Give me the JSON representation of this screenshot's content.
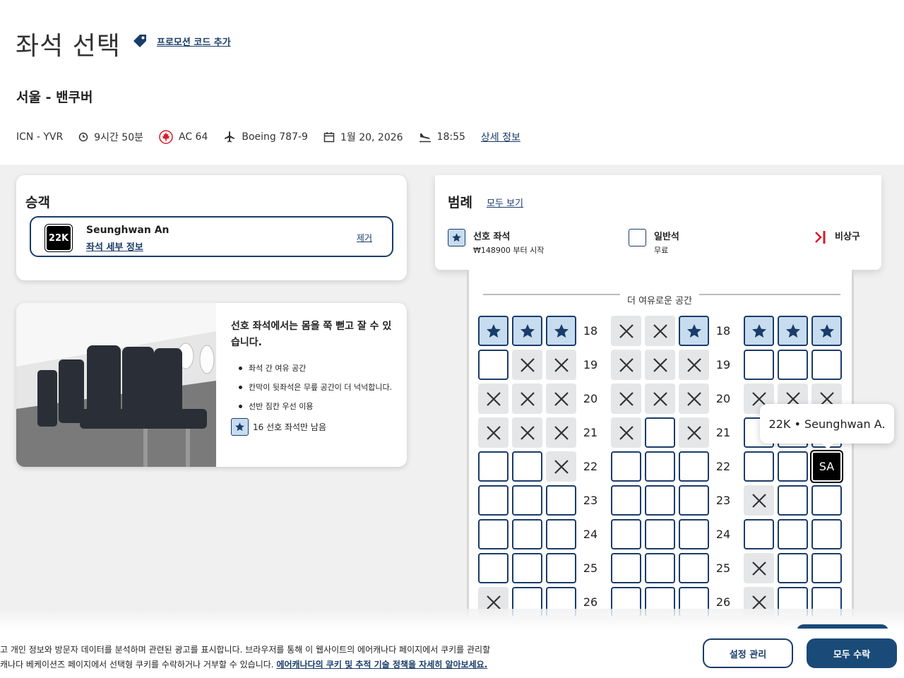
{
  "header": {
    "title": "좌석 선택",
    "promo_link": "프로모션 코드 추가",
    "route": "서울 - 밴쿠버",
    "flight": {
      "airports": "ICN - YVR",
      "duration": "9시간 50분",
      "flight_number": "AC 64",
      "aircraft": "Boeing 787-9",
      "date": "1월 20, 2026",
      "arrival_time": "18:55",
      "details_link": "상세 정보"
    }
  },
  "passenger": {
    "heading": "승객",
    "seat": "22K",
    "name": "Seunghwan An",
    "seat_details_link": "좌석 세부 정보",
    "remove_link": "제거"
  },
  "preferred_info": {
    "title": "선호 좌석에서는 몸을 쭉 뻗고 잘 수 있습니다.",
    "bullets": [
      "좌석 간 여유 공간",
      "칸막이 뒷좌석은 무릎 공간이 더 넉넉합니다.",
      "선반 짐칸 우선 이용"
    ],
    "remaining": "16 선호 좌석만 남음"
  },
  "legend": {
    "heading": "범례",
    "see_all": "모두 보기",
    "preferred_label": "선호 좌석",
    "preferred_price": "₩148900 부터 시작",
    "regular_label": "일반석",
    "regular_price": "무료",
    "exit_label": "비상구"
  },
  "seatmap": {
    "section_label": "더 여유로운 공간",
    "rows": [
      {
        "num": "18",
        "seats": [
          "P",
          "P",
          "P",
          "X",
          "X",
          "P",
          "P",
          "P",
          "P"
        ]
      },
      {
        "num": "19",
        "seats": [
          "A",
          "X",
          "X",
          "X",
          "X",
          "X",
          "A",
          "A",
          "A"
        ]
      },
      {
        "num": "20",
        "seats": [
          "X",
          "X",
          "X",
          "X",
          "X",
          "X",
          "X",
          "X",
          "X"
        ]
      },
      {
        "num": "21",
        "seats": [
          "X",
          "X",
          "X",
          "X",
          "A",
          "X",
          "A",
          "A",
          "A"
        ]
      },
      {
        "num": "22",
        "seats": [
          "A",
          "A",
          "X",
          "A",
          "A",
          "A",
          "A",
          "A",
          "S"
        ]
      },
      {
        "num": "23",
        "seats": [
          "A",
          "A",
          "A",
          "A",
          "A",
          "A",
          "X",
          "A",
          "A"
        ]
      },
      {
        "num": "24",
        "seats": [
          "A",
          "A",
          "A",
          "A",
          "A",
          "A",
          "A",
          "A",
          "A"
        ]
      },
      {
        "num": "25",
        "seats": [
          "A",
          "A",
          "A",
          "A",
          "A",
          "A",
          "X",
          "A",
          "A"
        ]
      },
      {
        "num": "26",
        "seats": [
          "X",
          "A",
          "A",
          "A",
          "A",
          "A",
          "X",
          "A",
          "A"
        ]
      }
    ],
    "selected_initials": "SA",
    "tooltip": "22K • Seunghwan A."
  },
  "cookie": {
    "line1": "고 개인 정보와 방문자 데이터를 분석하며 관련된 광고를 표시합니다. 브라우저를 통해 이 웹사이트의 에어캐나다 페이지에서 쿠키를 관리할",
    "line2": "캐나다 베케이션즈 페이지에서 선택형 쿠키를 수락하거나 거부할 수 있습니다.",
    "policy_link": "에어캐나다의 쿠키 및 추적 기술 정책을 자세히 알아보세요.",
    "manage_button": "설정 관리",
    "accept_button": "모두 수락"
  },
  "colors": {
    "brand_navy": "#1a3c6a",
    "preferred_fill": "#c7dcef",
    "occupied_fill": "#e5e6e8",
    "exit_red": "#d7192a",
    "maple_red": "#d7192a"
  }
}
